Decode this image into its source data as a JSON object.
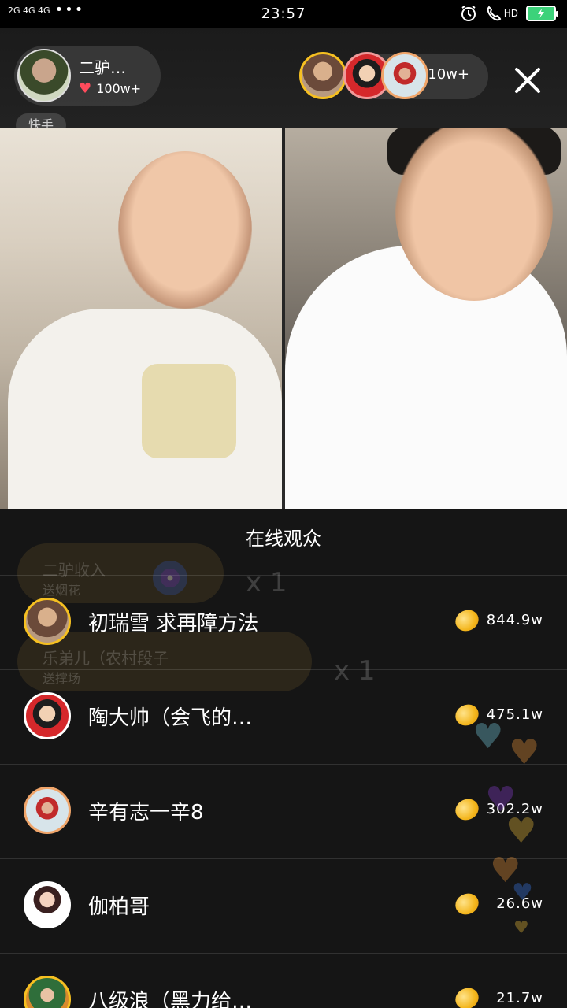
{
  "status_bar": {
    "network": "2G  4G 4G",
    "dots": "•••",
    "time": "23:57",
    "hd": "HD",
    "battery_color": "#3cd27a"
  },
  "header": {
    "host_name": "二驴…",
    "host_likes": "100w+",
    "brand": "快手",
    "viewer_count": "10w+"
  },
  "gifts": [
    {
      "line1": "二驴收入",
      "line2": "送烟花",
      "count": "x 1"
    },
    {
      "line1": "乐弟儿（农村段子",
      "line2": "送撑场",
      "count": "x 1"
    }
  ],
  "sheet": {
    "title": "在线观众",
    "rows": [
      {
        "name": "初瑞雪 求再障方法",
        "value": "844.9w",
        "avatar_color": "#d3a67f",
        "border": "#f6c021"
      },
      {
        "name": "陶大帅（会飞的…",
        "value": "475.1w",
        "avatar_color": "#d5282b",
        "border": "#ffffff"
      },
      {
        "name": "辛有志一辛8",
        "value": "302.2w",
        "avatar_color": "#c12a2a",
        "border": "#f0a56a"
      },
      {
        "name": "伽柏哥",
        "value": "26.6w",
        "avatar_color": "#8a1f2a",
        "border": "#ffffff"
      },
      {
        "name": "八级浪（黑力给…",
        "value": "21.7w",
        "avatar_color": "#2f6e3a",
        "border": "#f6c021"
      }
    ]
  },
  "colors": {
    "accent_gold": "#f6c021",
    "heart_red": "#ff4b5c"
  }
}
